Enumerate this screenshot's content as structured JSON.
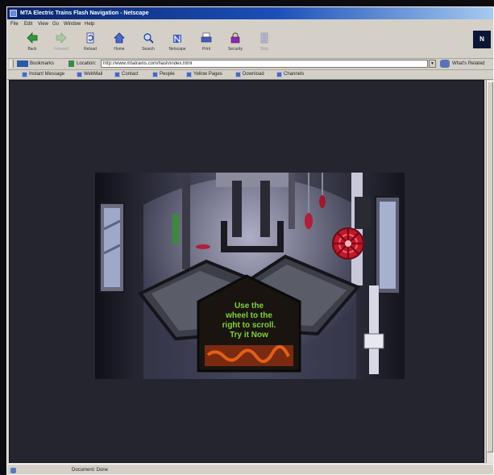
{
  "window": {
    "title": "MTA Electric Trains Flash Navigation - Netscape"
  },
  "menu": [
    "File",
    "Edit",
    "View",
    "Go",
    "Window",
    "Help"
  ],
  "toolbar": {
    "buttons": [
      {
        "label": "Back",
        "icon": "back-arrow-icon",
        "enabled": true
      },
      {
        "label": "Forward",
        "icon": "forward-arrow-icon",
        "enabled": false
      },
      {
        "label": "Reload",
        "icon": "reload-icon",
        "enabled": true
      },
      {
        "label": "Home",
        "icon": "home-icon",
        "enabled": true
      },
      {
        "label": "Search",
        "icon": "search-icon",
        "enabled": true
      },
      {
        "label": "Netscape",
        "icon": "netscape-icon",
        "enabled": true
      },
      {
        "label": "Print",
        "icon": "print-icon",
        "enabled": true
      },
      {
        "label": "Security",
        "icon": "security-lock-icon",
        "enabled": true
      },
      {
        "label": "Stop",
        "icon": "stop-icon",
        "enabled": false
      }
    ],
    "logo": "N"
  },
  "location": {
    "bookmarks_label": "Bookmarks",
    "location_label": "Location:",
    "url": "http://www.mtatrains.com/flash/index.html",
    "whats_related": "What's Related"
  },
  "personal_toolbar": [
    {
      "label": "Instant Message"
    },
    {
      "label": "WebMail"
    },
    {
      "label": "Contact"
    },
    {
      "label": "People"
    },
    {
      "label": "Yellow Pages"
    },
    {
      "label": "Download"
    },
    {
      "label": "Channels"
    }
  ],
  "flash": {
    "instruction_lines": [
      "Use the",
      "wheel to the",
      "right to scroll.",
      "Try it Now"
    ]
  },
  "status": {
    "text": "Document: Done"
  },
  "colors": {
    "titlebar": "#0a246a",
    "chrome": "#d4d0c8",
    "content_bg": "#24252e",
    "instruction_text": "#7fd43a",
    "wheel_red": "#c0182a"
  }
}
